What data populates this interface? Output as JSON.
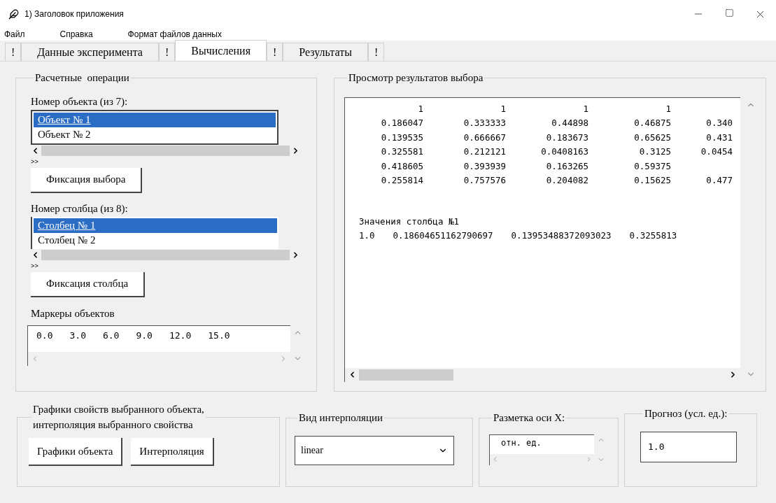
{
  "window": {
    "title": "1) Заголовок приложения"
  },
  "menu": [
    "Файл",
    "Справка",
    "Формат файлов данных"
  ],
  "tabs": [
    {
      "label": "!",
      "selected": false
    },
    {
      "label": "Данные эксперимента",
      "selected": false
    },
    {
      "label": "!",
      "selected": false
    },
    {
      "label": "Вычисления",
      "selected": true
    },
    {
      "label": "!",
      "selected": false
    },
    {
      "label": "Результаты",
      "selected": false
    },
    {
      "label": "!",
      "selected": false
    }
  ],
  "operations": {
    "title": "Расчетные  операции",
    "object_list": {
      "label": "Номер объекта (из 7):",
      "items": [
        {
          "label": "Объект №  1",
          "selected": true
        },
        {
          "label": "Объект №  2",
          "selected": false
        }
      ],
      "more": ">>",
      "button": "Фиксация  выбора"
    },
    "column_list": {
      "label": "Номер столбца (из 8):",
      "items": [
        {
          "label": "Столбец №  1",
          "selected": true
        },
        {
          "label": "Столбец №  2",
          "selected": false
        }
      ],
      "more": ">>",
      "button": "Фиксация  столбца"
    },
    "markers": {
      "label": "Маркеры объектов",
      "values": [
        "0.0",
        "3.0",
        "6.0",
        "9.0",
        "12.0",
        "15.0"
      ]
    }
  },
  "results": {
    "title": "Просмотр результатов выбора",
    "rows": [
      [
        "1",
        "1",
        "1",
        "1",
        ""
      ],
      [
        "0.186047",
        "0.333333",
        "0.44898",
        "0.46875",
        "0.340"
      ],
      [
        "0.139535",
        "0.666667",
        "0.183673",
        "0.65625",
        "0.431"
      ],
      [
        "0.325581",
        "0.212121",
        "0.0408163",
        "0.3125",
        "0.0454"
      ],
      [
        "0.418605",
        "0.393939",
        "0.163265",
        "0.59375",
        ""
      ],
      [
        "0.255814",
        "0.757576",
        "0.204082",
        "0.15625",
        "0.477"
      ]
    ],
    "column_heading": "Значения столбца №1",
    "column_values": [
      "1.0",
      "0.18604651162790697",
      "0.13953488372093023",
      "0.3255813"
    ]
  },
  "plots": {
    "title": "Графики свойств выбранного объекта,\nинтерполяция выбранного свойства",
    "buttons": [
      "Графики  объекта",
      "Интерполяция"
    ]
  },
  "interpolation": {
    "title": "Вид интерполяции",
    "value": "linear"
  },
  "axis": {
    "title": "Разметка оси X:",
    "value": "отн. ед."
  },
  "forecast": {
    "title": "Прогноз (усл. ед.):",
    "value": "1.0"
  }
}
